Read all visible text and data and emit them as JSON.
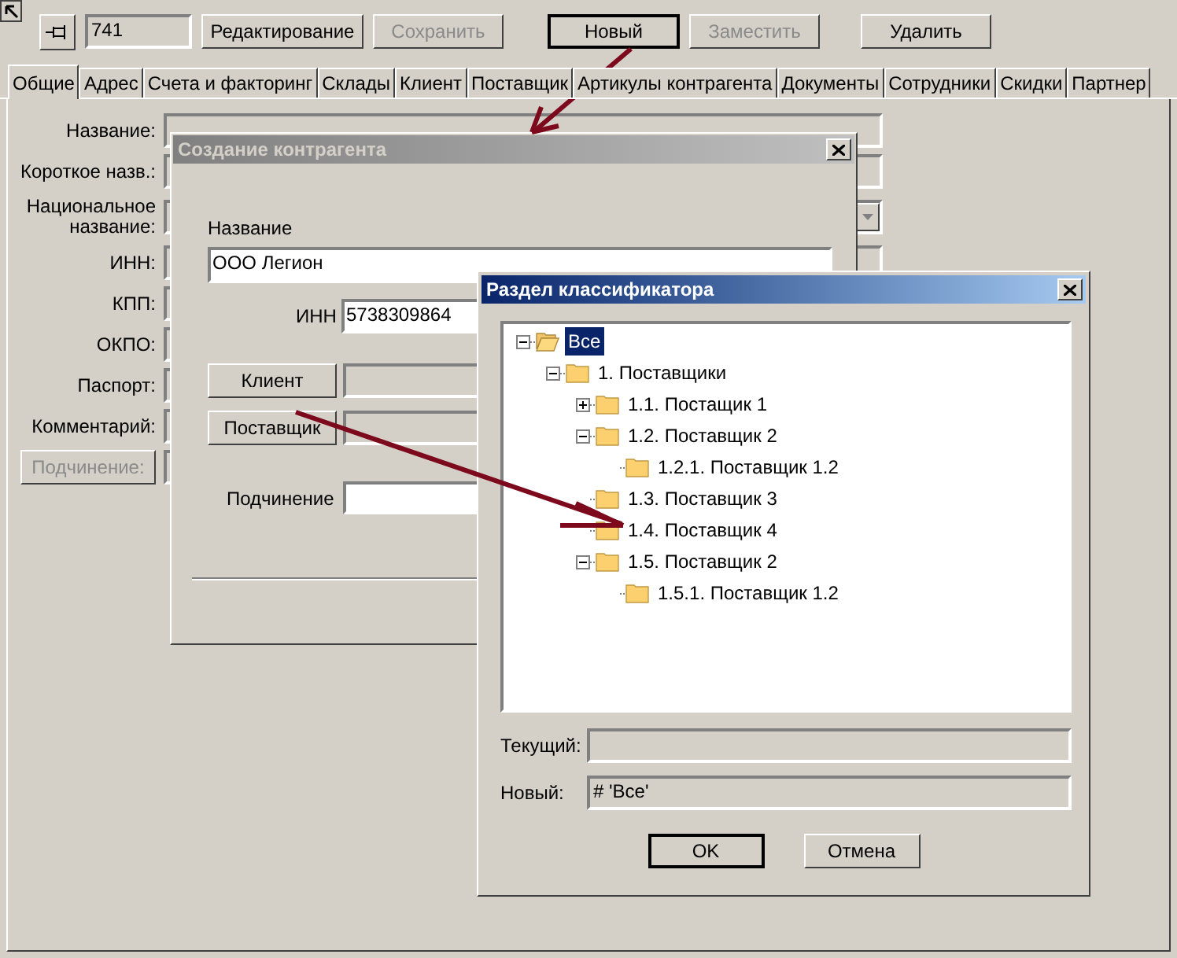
{
  "toolbar": {
    "record_id": "741",
    "buttons": [
      {
        "label": "Редактирование",
        "disabled": false,
        "default": false
      },
      {
        "label": "Сохранить",
        "disabled": true,
        "default": false
      },
      {
        "label": "Новый",
        "disabled": false,
        "default": true
      },
      {
        "label": "Заместить",
        "disabled": true,
        "default": false
      },
      {
        "label": "Удалить",
        "disabled": false,
        "default": false
      }
    ]
  },
  "tabs": [
    {
      "label": "Общие",
      "selected": true
    },
    {
      "label": "Адрес",
      "selected": false
    },
    {
      "label": "Счета и факторинг",
      "selected": false
    },
    {
      "label": "Склады",
      "selected": false
    },
    {
      "label": "Клиент",
      "selected": false
    },
    {
      "label": "Поставщик",
      "selected": false
    },
    {
      "label": "Артикулы контрагента",
      "selected": false
    },
    {
      "label": "Документы",
      "selected": false
    },
    {
      "label": "Сотрудники",
      "selected": false
    },
    {
      "label": "Скидки",
      "selected": false
    },
    {
      "label": "Партнер",
      "selected": false
    }
  ],
  "form": {
    "fields": [
      {
        "label": "Название:",
        "kind": "text"
      },
      {
        "label": "Короткое назв.:",
        "kind": "text"
      },
      {
        "label": "Национальное название:",
        "kind": "dropdown"
      },
      {
        "label": "ИНН:",
        "kind": "text"
      },
      {
        "label": "КПП:",
        "kind": "text"
      },
      {
        "label": "ОКПО:",
        "kind": "text"
      },
      {
        "label": "Паспорт:",
        "kind": "text"
      },
      {
        "label": "Комментарий:",
        "kind": "text"
      }
    ],
    "subordination_button": {
      "label": "Подчинение:",
      "disabled": true
    }
  },
  "create_dialog": {
    "title": "Создание контрагента",
    "active": false,
    "name_label": "Название",
    "name_value": "ООО Легион",
    "inn_label": "ИНН",
    "inn_value": "5738309864",
    "client_button": "Клиент",
    "supplier_button": "Поставщик",
    "subordination_label": "Подчинение"
  },
  "classifier_dialog": {
    "title": "Раздел классификатора",
    "active": true,
    "tree": [
      {
        "label": "Все",
        "selected": true,
        "expanded": true,
        "children": [
          {
            "label": "1. Поставщики",
            "selected": false,
            "expanded": true,
            "children": [
              {
                "label": "1.1. Постащик 1",
                "selected": false,
                "expanded": false
              },
              {
                "label": "1.2. Поставщик 2",
                "selected": false,
                "expanded": true,
                "children": [
                  {
                    "label": "1.2.1. Поставщик 1.2",
                    "selected": false
                  }
                ]
              },
              {
                "label": "1.3. Поставщик 3",
                "selected": false
              },
              {
                "label": "1.4. Поставщик 4",
                "selected": false
              },
              {
                "label": "1.5. Поставщик 2",
                "selected": false,
                "expanded": true,
                "children": [
                  {
                    "label": "1.5.1. Поставщик 1.2",
                    "selected": false
                  }
                ]
              }
            ]
          }
        ]
      }
    ],
    "current_label": "Текущий:",
    "new_label": "Новый:",
    "new_value": "# 'Все'",
    "buttons": [
      {
        "label": "OK",
        "default": true
      },
      {
        "label": "Отмена",
        "default": false
      }
    ]
  }
}
